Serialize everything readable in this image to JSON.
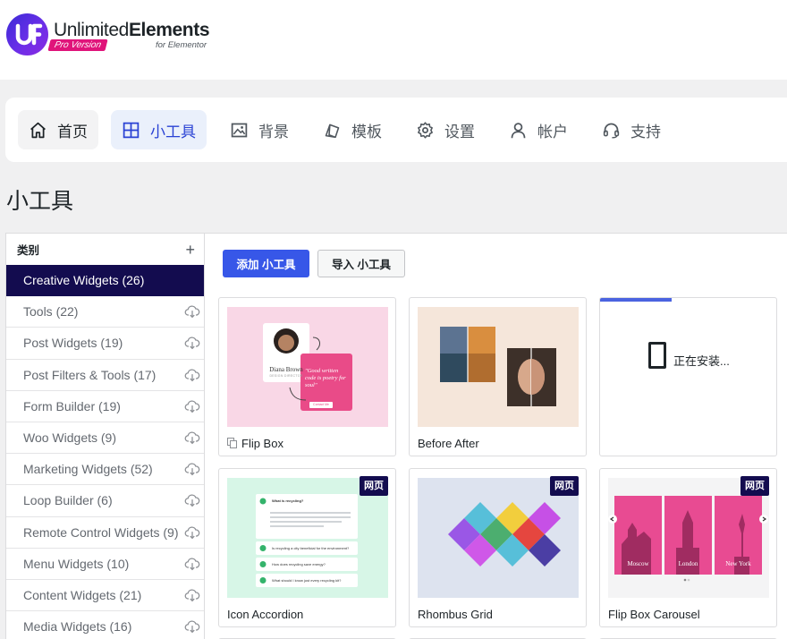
{
  "brand": {
    "name_light": "Unlimited",
    "name_bold": "Elements",
    "pro_label": "Pro Version",
    "for_label": "for Elementor",
    "colors": {
      "brand": "#5b2be0",
      "pro_badge": "#e0147a"
    }
  },
  "nav": {
    "items": [
      {
        "label": "首页",
        "icon": "home-icon"
      },
      {
        "label": "小工具",
        "icon": "grid-icon",
        "active": true
      },
      {
        "label": "背景",
        "icon": "image-icon"
      },
      {
        "label": "模板",
        "icon": "template-icon"
      },
      {
        "label": "设置",
        "icon": "gear-icon"
      },
      {
        "label": "帐户",
        "icon": "user-icon"
      },
      {
        "label": "支持",
        "icon": "headset-icon"
      }
    ],
    "active_color": "#2a42d4"
  },
  "page": {
    "title": "小工具"
  },
  "sidebar": {
    "header": "类别",
    "add_symbol": "+",
    "categories": [
      {
        "label": "Creative Widgets (26)",
        "active": true
      },
      {
        "label": "Tools (22)"
      },
      {
        "label": "Post Widgets (19)"
      },
      {
        "label": "Post Filters & Tools (17)"
      },
      {
        "label": "Form Builder (19)"
      },
      {
        "label": "Woo Widgets (9)"
      },
      {
        "label": "Marketing Widgets (52)"
      },
      {
        "label": "Loop Builder (6)"
      },
      {
        "label": "Remote Control Widgets (9)"
      },
      {
        "label": "Menu Widgets (10)"
      },
      {
        "label": "Content Widgets (21)"
      },
      {
        "label": "Media Widgets (16)"
      }
    ],
    "active_color": "#130c4f"
  },
  "toolbar": {
    "add_label": "添加 小工具",
    "import_label": "导入 小工具"
  },
  "widgets": {
    "page_badge": "网页",
    "installing_label": "正在安装...",
    "cards": [
      {
        "name": "Flip Box"
      },
      {
        "name": "Before After"
      },
      {
        "name": ""
      },
      {
        "name": "Icon Accordion"
      },
      {
        "name": "Rhombus Grid"
      },
      {
        "name": "Flip Box Carousel"
      }
    ],
    "flipbox_preview": {
      "person_name": "Diana Brown",
      "person_role": "DESIGN DIRECTOR",
      "quote": "\"Good written code is poetry for soul\"",
      "cta": "Contact Me"
    },
    "accordion_preview": {
      "items": [
        "What is recycling?",
        "Is recycling a city beneficial for the environment?",
        "How does recycling save energy?",
        "What should I know just every recycling kit?"
      ]
    },
    "carousel_preview": {
      "cities": [
        "Moscow",
        "London",
        "New York"
      ]
    }
  }
}
